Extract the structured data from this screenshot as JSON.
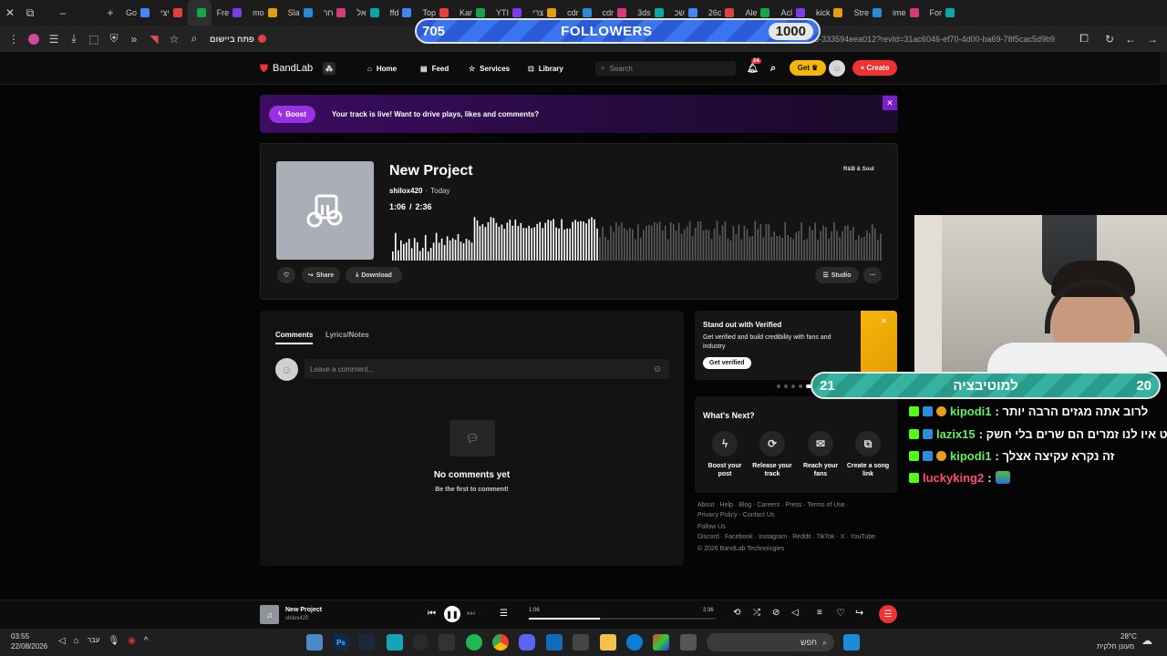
{
  "browser": {
    "tabs": [
      "Go",
      "יצי",
      "",
      "Fre",
      "mo",
      "Sla",
      "חר",
      "אל",
      "ffd",
      "Top",
      "Kar",
      "YTI",
      "צרי",
      "cdr",
      "cdr",
      "3ds",
      "שכ",
      "26c",
      "Ale",
      "Acl",
      "kick",
      "Stre",
      "ime",
      "For"
    ],
    "active_tab_index": 2,
    "address_text": "m/track/d445a80f-4fa1-4ea9-9568-333594eea012?revId=31ac6046-ef70-4d00-ba69-78f5cac5d9b9",
    "open_in_app": "פתח ביישום"
  },
  "followers_overlay": {
    "current": "705",
    "label": "FOLLOWERS",
    "goal": "1000"
  },
  "nav": {
    "logo": "BandLab",
    "home": "Home",
    "feed": "Feed",
    "services": "Services",
    "library": "Library",
    "search_placeholder": "Search",
    "notif_count": "24",
    "get_label": "Get",
    "create_label": "+ Create"
  },
  "boost_banner": {
    "button": "Boost",
    "message": "Your track is live! Want to drive plays, likes and comments?"
  },
  "track": {
    "title": "New Project",
    "artist": "shilox420",
    "date": "Today",
    "current_time": "1:06",
    "duration": "2:36",
    "genre": "R&B & Soul",
    "share": "Share",
    "download": "Download",
    "studio": "Studio",
    "progress": 0.423
  },
  "comments": {
    "tab_comments": "Comments",
    "tab_lyrics": "Lyrics/Notes",
    "input_placeholder": "Leave a comment...",
    "empty_title": "No comments yet",
    "empty_sub": "Be the first to comment!"
  },
  "verified_card": {
    "title": "Stand out with Verified",
    "body": "Get verified and build credibility with fans and industry",
    "button": "Get verified"
  },
  "whats_next": {
    "title": "What's Next?",
    "items": [
      {
        "icon": "bolt-icon",
        "label": "Boost your post"
      },
      {
        "icon": "release-icon",
        "label": "Release your track"
      },
      {
        "icon": "mail-icon",
        "label": "Reach your fans"
      },
      {
        "icon": "link-icon",
        "label": "Create a song link"
      }
    ]
  },
  "footer": {
    "line1": "About · Help · Blog · Careers · Press · Terms of Use ·",
    "line2": "Privacy Policy · Contact Us",
    "follow": "Follow Us",
    "line3": "Discord · Facebook · Instagram · Reddit · TikTok · X · YouTube",
    "copyright": "© 2026 BandLab Technologies"
  },
  "motivation_overlay": {
    "left": "21",
    "label": "למוטיבציה",
    "right": "20"
  },
  "chat": [
    {
      "user": "kipodi1",
      "color": "#5ff05f",
      "message": ": לרוב אתה מגזים הרבה יותר"
    },
    {
      "user": "lazix15",
      "color": "#5ff05f",
      "message": ": פשוט איו לנו זמרים הם שרים בלי חשק"
    },
    {
      "user": "kipodi1",
      "color": "#5ff05f",
      "message": ": זה נקרא עקיצה אצלך"
    },
    {
      "user": "luckyking2",
      "color": "#ff4d6d",
      "message": ":"
    }
  ],
  "player": {
    "title": "New Project",
    "artist": "shilox420",
    "time_current": "1:06",
    "time_total": "2:36",
    "progress": 0.423
  },
  "taskbar": {
    "time": "03:55",
    "date": "22/08/2026",
    "lang": "עבר",
    "search": "חפש",
    "temp": "28°C",
    "weather": "מעונן חלקית"
  },
  "colors": {
    "accent": "#f03232",
    "boost": "#9b2fe3",
    "chat_name": "#5ff05f"
  }
}
